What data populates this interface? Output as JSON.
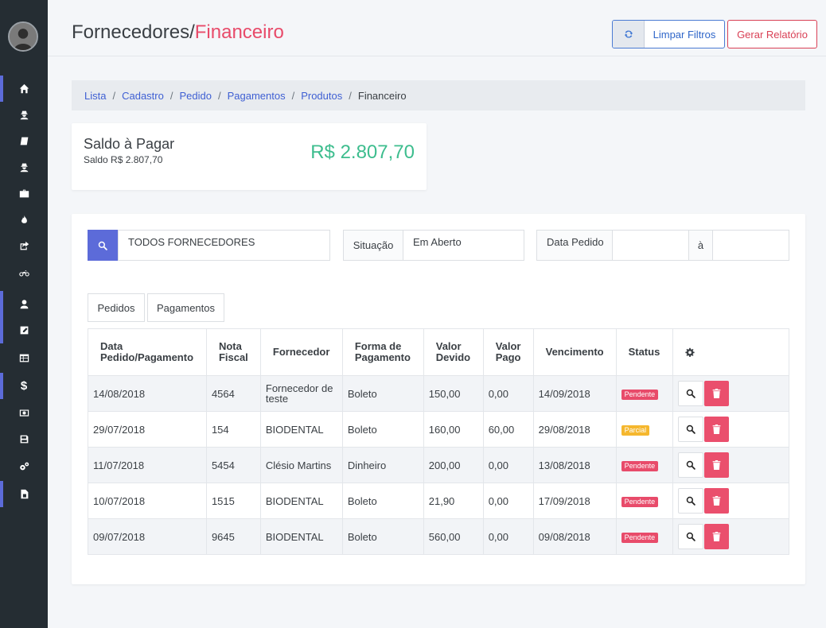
{
  "header": {
    "title_main": "Fornecedores/",
    "title_accent": "Financeiro",
    "clear_filters_label": "Limpar Filtros",
    "report_label": "Gerar Relatório"
  },
  "sidebar": {
    "items": [
      {
        "icon": "home-icon",
        "active": true
      },
      {
        "icon": "user-secret-icon"
      },
      {
        "icon": "book-icon"
      },
      {
        "icon": "user-secret-icon"
      },
      {
        "icon": "briefcase-icon"
      },
      {
        "icon": "fire-icon"
      },
      {
        "icon": "share-icon"
      },
      {
        "icon": "motorcycle-icon"
      },
      {
        "icon": "user-icon",
        "active": true
      },
      {
        "icon": "edit-icon",
        "active": true
      },
      {
        "icon": "table-icon"
      },
      {
        "icon": "dollar-icon",
        "active": true,
        "text": "$"
      },
      {
        "icon": "money-icon"
      },
      {
        "icon": "save-icon"
      },
      {
        "icon": "cogs-icon"
      },
      {
        "icon": "file-icon",
        "active": true
      }
    ]
  },
  "breadcrumb": {
    "items": [
      "Lista",
      "Cadastro",
      "Pedido",
      "Pagamentos",
      "Produtos"
    ],
    "current": "Financeiro",
    "separator": "/"
  },
  "balance": {
    "title": "Saldo à Pagar",
    "subtitle": "Saldo R$ 2.807,70",
    "amount": "R$ 2.807,70"
  },
  "filters": {
    "supplier_value": "TODOS FORNECEDORES",
    "situation_label": "Situação",
    "situation_value": "Em Aberto",
    "date_label": "Data Pedido",
    "date_separator": "à"
  },
  "tabs": [
    "Pedidos",
    "Pagamentos"
  ],
  "table": {
    "headers": [
      "Data Pedido/Pagamento",
      "Nota Fiscal",
      "Fornecedor",
      "Forma de Pagamento",
      "Valor Devido",
      "Valor Pago",
      "Vencimento",
      "Status"
    ],
    "rows": [
      {
        "date": "14/08/2018",
        "nf": "4564",
        "supplier": "Fornecedor de teste",
        "payment": "Boleto",
        "due": "150,00",
        "paid": "0,00",
        "expiry": "14/09/2018",
        "status": "Pendente",
        "status_color": "#e84b6a"
      },
      {
        "date": "29/07/2018",
        "nf": "154",
        "supplier": "BIODENTAL",
        "payment": "Boleto",
        "due": "160,00",
        "paid": "60,00",
        "expiry": "29/08/2018",
        "status": "Parcial",
        "status_color": "#f5b72e"
      },
      {
        "date": "11/07/2018",
        "nf": "5454",
        "supplier": "Clésio Martins",
        "payment": "Dinheiro",
        "due": "200,00",
        "paid": "0,00",
        "expiry": "13/08/2018",
        "status": "Pendente",
        "status_color": "#e84b6a"
      },
      {
        "date": "10/07/2018",
        "nf": "1515",
        "supplier": "BIODENTAL",
        "payment": "Boleto",
        "due": "21,90",
        "paid": "0,00",
        "expiry": "17/09/2018",
        "status": "Pendente",
        "status_color": "#e84b6a"
      },
      {
        "date": "09/07/2018",
        "nf": "9645",
        "supplier": "BIODENTAL",
        "payment": "Boleto",
        "due": "560,00",
        "paid": "0,00",
        "expiry": "09/08/2018",
        "status": "Pendente",
        "status_color": "#e84b6a"
      }
    ]
  },
  "colors": {
    "accent": "#e84b6a",
    "primary": "#5c6bd9",
    "success": "#3dbd8e",
    "sidebar": "#252d33"
  }
}
